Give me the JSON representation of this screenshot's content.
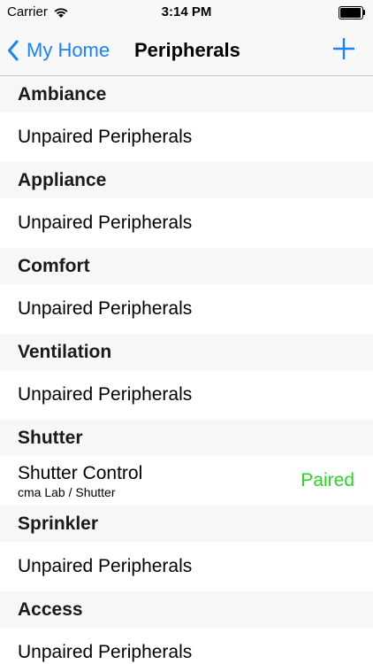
{
  "status_bar": {
    "carrier": "Carrier",
    "time": "3:14 PM",
    "wifi_icon": "wifi-icon",
    "battery_icon": "battery-icon"
  },
  "nav": {
    "back_label": "My Home",
    "title": "Peripherals",
    "back_icon": "chevron-left-icon",
    "add_icon": "plus-icon",
    "accent_color": "#1a82fb"
  },
  "sections": [
    {
      "header": "Ambiance",
      "row": {
        "title": "Unpaired Peripherals"
      }
    },
    {
      "header": "Appliance",
      "row": {
        "title": "Unpaired Peripherals"
      }
    },
    {
      "header": "Comfort",
      "row": {
        "title": "Unpaired Peripherals"
      }
    },
    {
      "header": "Ventilation",
      "row": {
        "title": "Unpaired Peripherals"
      }
    },
    {
      "header": "Shutter",
      "row": {
        "title": "Shutter Control",
        "subtitle": "cma Lab / Shutter",
        "status": "Paired",
        "status_color": "#2bd32b"
      }
    },
    {
      "header": "Sprinkler",
      "row": {
        "title": "Unpaired Peripherals"
      }
    },
    {
      "header": "Access",
      "row": {
        "title": "Unpaired Peripherals"
      }
    }
  ]
}
